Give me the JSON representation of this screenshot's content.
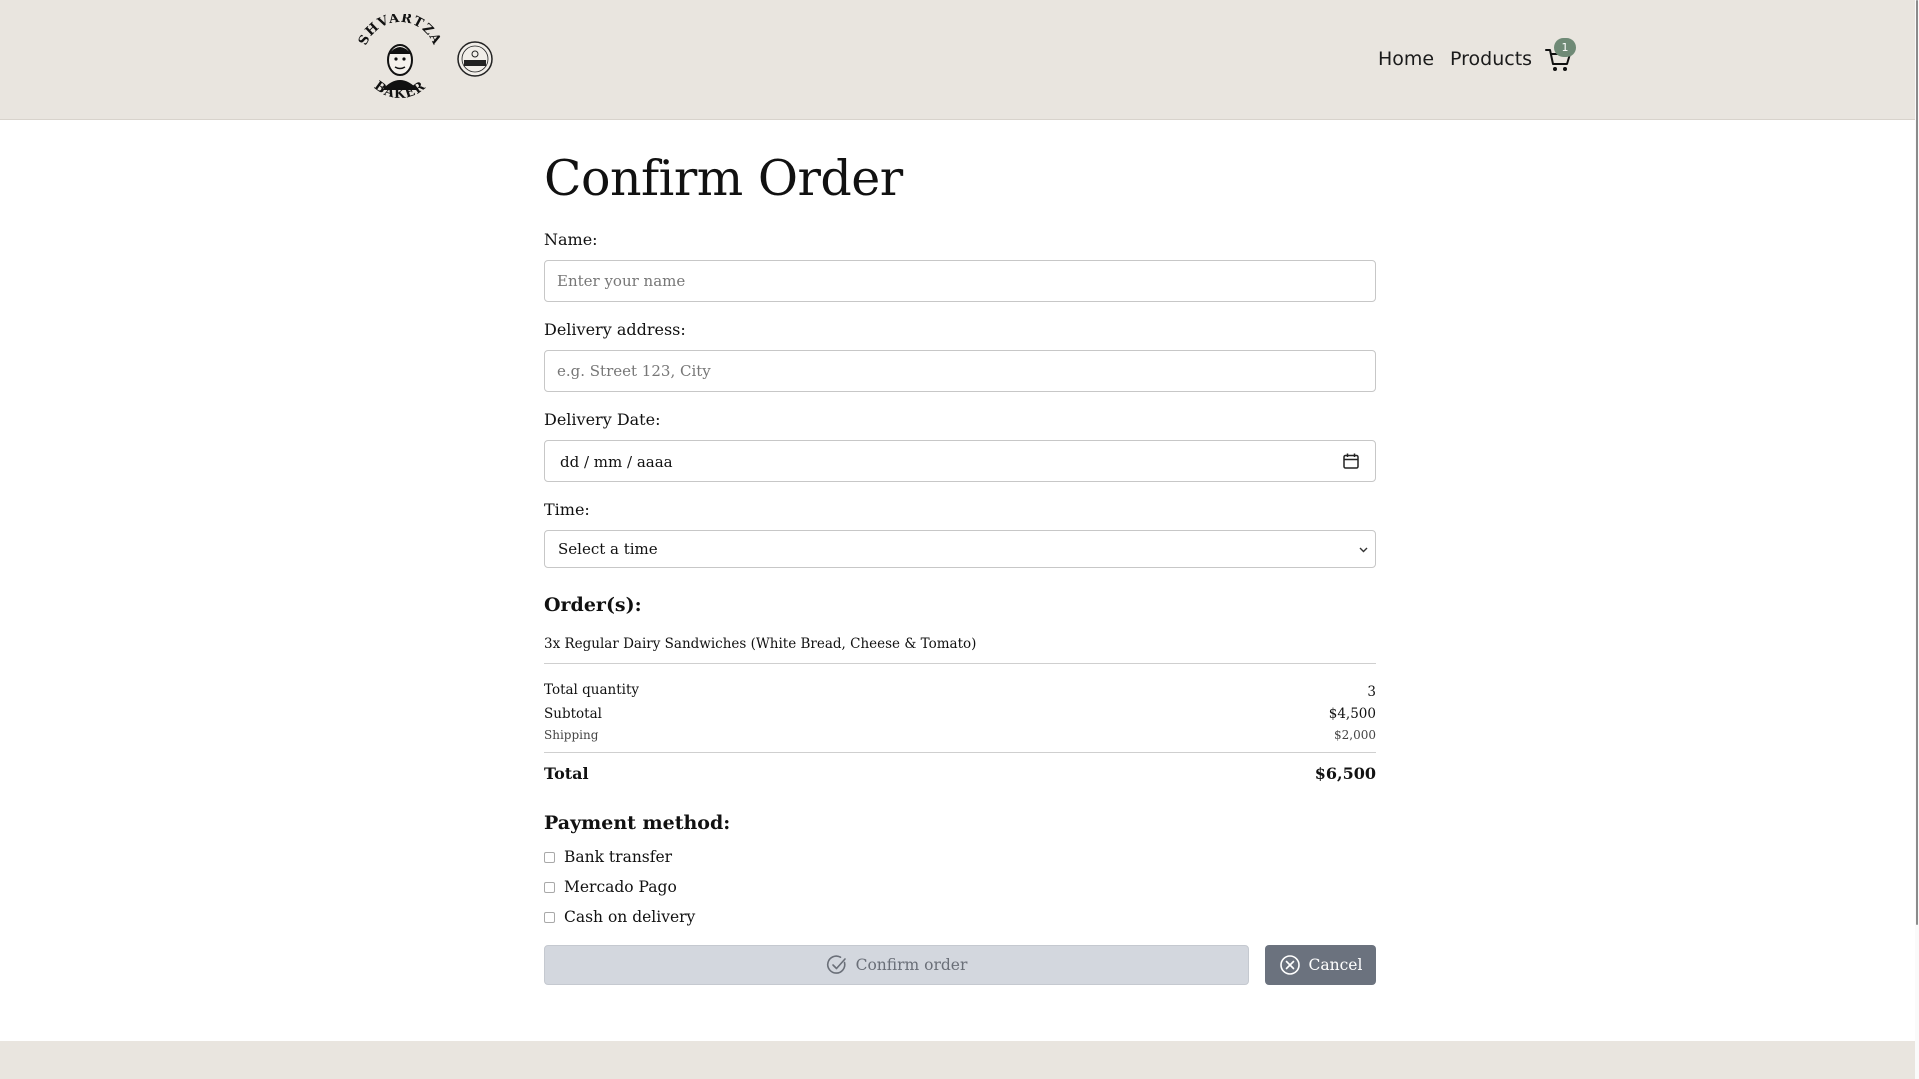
{
  "header": {
    "logo_text_top": "SHVARTZA",
    "logo_text_bottom": "BAKER",
    "nav": {
      "home": "Home",
      "products": "Products"
    },
    "cart_count": "1"
  },
  "page": {
    "title": "Confirm Order"
  },
  "form": {
    "name_label": "Name:",
    "name_placeholder": "Enter your name",
    "address_label": "Delivery address:",
    "address_placeholder": "e.g. Street 123, City",
    "date_label": "Delivery Date:",
    "date_placeholder": "dd / mm / aaaa",
    "time_label": "Time:",
    "time_selected": "Select a time"
  },
  "order": {
    "heading": "Order(s):",
    "items": [
      "3x Regular Dairy Sandwiches (White Bread, Cheese & Tomato)"
    ],
    "total_quantity_label": "Total quantity",
    "total_quantity": "3",
    "subtotal_label": "Subtotal",
    "subtotal": "$4,500",
    "shipping_label": "Shipping",
    "shipping": "$2,000",
    "total_label": "Total",
    "total": "$6,500"
  },
  "payment": {
    "heading": "Payment method:",
    "options": [
      "Bank transfer",
      "Mercado Pago",
      "Cash on delivery"
    ]
  },
  "actions": {
    "confirm": "Confirm order",
    "cancel": "Cancel"
  },
  "colors": {
    "header_bg": "#e9e5df",
    "badge": "#6f8a76",
    "confirm_bg": "#d3d7de",
    "cancel_bg": "#6b727e"
  }
}
